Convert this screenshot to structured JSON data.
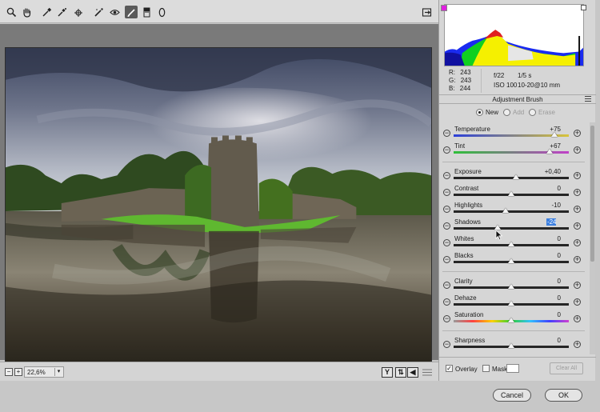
{
  "toolbar": {
    "tools": [
      {
        "name": "zoom-tool",
        "icon": "magnifier-icon"
      },
      {
        "name": "hand-tool",
        "icon": "hand-icon"
      },
      {
        "name": "white-balance-tool",
        "icon": "eyedropper-icon"
      },
      {
        "name": "color-sampler-tool",
        "icon": "color-sampler-icon"
      },
      {
        "name": "targeted-adjustment-tool",
        "icon": "target-icon"
      },
      {
        "name": "spot-removal-tool",
        "icon": "spot-removal-icon"
      },
      {
        "name": "red-eye-tool",
        "icon": "eye-icon"
      },
      {
        "name": "adjustment-brush-tool",
        "icon": "brush-icon",
        "active": true
      },
      {
        "name": "graduated-filter-tool",
        "icon": "gradient-icon"
      },
      {
        "name": "radial-filter-tool",
        "icon": "ellipse-icon"
      }
    ],
    "export_icon": "open-in-icon"
  },
  "preview": {
    "zoom_value": "22,6%"
  },
  "histogram": {
    "r_label": "R:",
    "r_value": "243",
    "g_label": "G:",
    "g_value": "243",
    "b_label": "B:",
    "b_value": "244",
    "aperture": "f/22",
    "shutter": "1/5 s",
    "iso": "ISO 100",
    "lens": "10-20@10 mm",
    "clip_shadow_color": "#e020e0"
  },
  "adjustment_brush": {
    "title": "Adjustment Brush",
    "modes": [
      {
        "label": "New",
        "selected": true,
        "enabled": true
      },
      {
        "label": "Add",
        "selected": false,
        "enabled": false
      },
      {
        "label": "Erase",
        "selected": false,
        "enabled": false
      }
    ],
    "sliders": [
      {
        "label": "Temperature",
        "value": "+75",
        "pos": 0.875,
        "track": "temperature"
      },
      {
        "label": "Tint",
        "value": "+67",
        "pos": 0.835,
        "track": "tint"
      },
      {
        "label": "Exposure",
        "value": "+0,40",
        "pos": 0.54,
        "track": "plain"
      },
      {
        "label": "Contrast",
        "value": "0",
        "pos": 0.5,
        "track": "plain"
      },
      {
        "label": "Highlights",
        "value": "-10",
        "pos": 0.45,
        "track": "plain"
      },
      {
        "label": "Shadows",
        "value": "-24",
        "pos": 0.38,
        "track": "plain",
        "selected": true
      },
      {
        "label": "Whites",
        "value": "0",
        "pos": 0.5,
        "track": "plain"
      },
      {
        "label": "Blacks",
        "value": "0",
        "pos": 0.5,
        "track": "plain"
      },
      {
        "label": "Clarity",
        "value": "0",
        "pos": 0.5,
        "track": "plain"
      },
      {
        "label": "Dehaze",
        "value": "0",
        "pos": 0.5,
        "track": "plain"
      },
      {
        "label": "Saturation",
        "value": "0",
        "pos": 0.5,
        "track": "saturation"
      },
      {
        "label": "Sharpness",
        "value": "0",
        "pos": 0.5,
        "track": "plain"
      }
    ],
    "overlay_label": "Overlay",
    "overlay_checked": true,
    "mask_label": "Mask",
    "mask_checked": false,
    "clear_all_label": "Clear All"
  },
  "dialog": {
    "cancel_label": "Cancel",
    "ok_label": "OK"
  }
}
